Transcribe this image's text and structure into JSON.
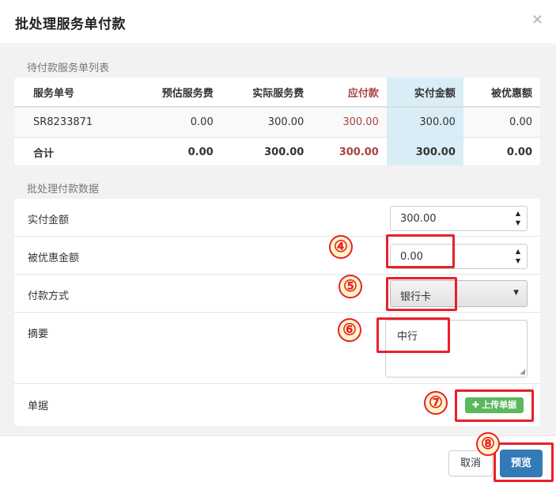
{
  "modal": {
    "title": "批处理服务单付款",
    "close_icon": "×"
  },
  "pending_section": {
    "title": "待付款服务单列表",
    "columns": [
      "服务单号",
      "预估服务费",
      "实际服务费",
      "应付款",
      "实付金额",
      "被优惠额"
    ],
    "rows": [
      [
        "SR8233871",
        "0.00",
        "300.00",
        "300.00",
        "300.00",
        "0.00"
      ]
    ],
    "total": [
      "合计",
      "0.00",
      "300.00",
      "300.00",
      "300.00",
      "0.00"
    ]
  },
  "payment_section": {
    "title": "批处理付款数据",
    "paid_amount": {
      "label": "实付金额",
      "value": "300.00"
    },
    "discount_amount": {
      "label": "被优惠金额",
      "value": "0.00"
    },
    "payment_method": {
      "label": "付款方式",
      "value": "银行卡"
    },
    "summary": {
      "label": "摘要",
      "value": "中行"
    },
    "document": {
      "label": "单据",
      "upload_label": "上传单据"
    }
  },
  "footer": {
    "cancel_label": "取消",
    "preview_label": "预览"
  },
  "annotations": {
    "marker_4": "④",
    "marker_5": "⑤",
    "marker_6": "⑥",
    "marker_7": "⑦",
    "marker_8": "⑧",
    "color": "#e8202a"
  }
}
